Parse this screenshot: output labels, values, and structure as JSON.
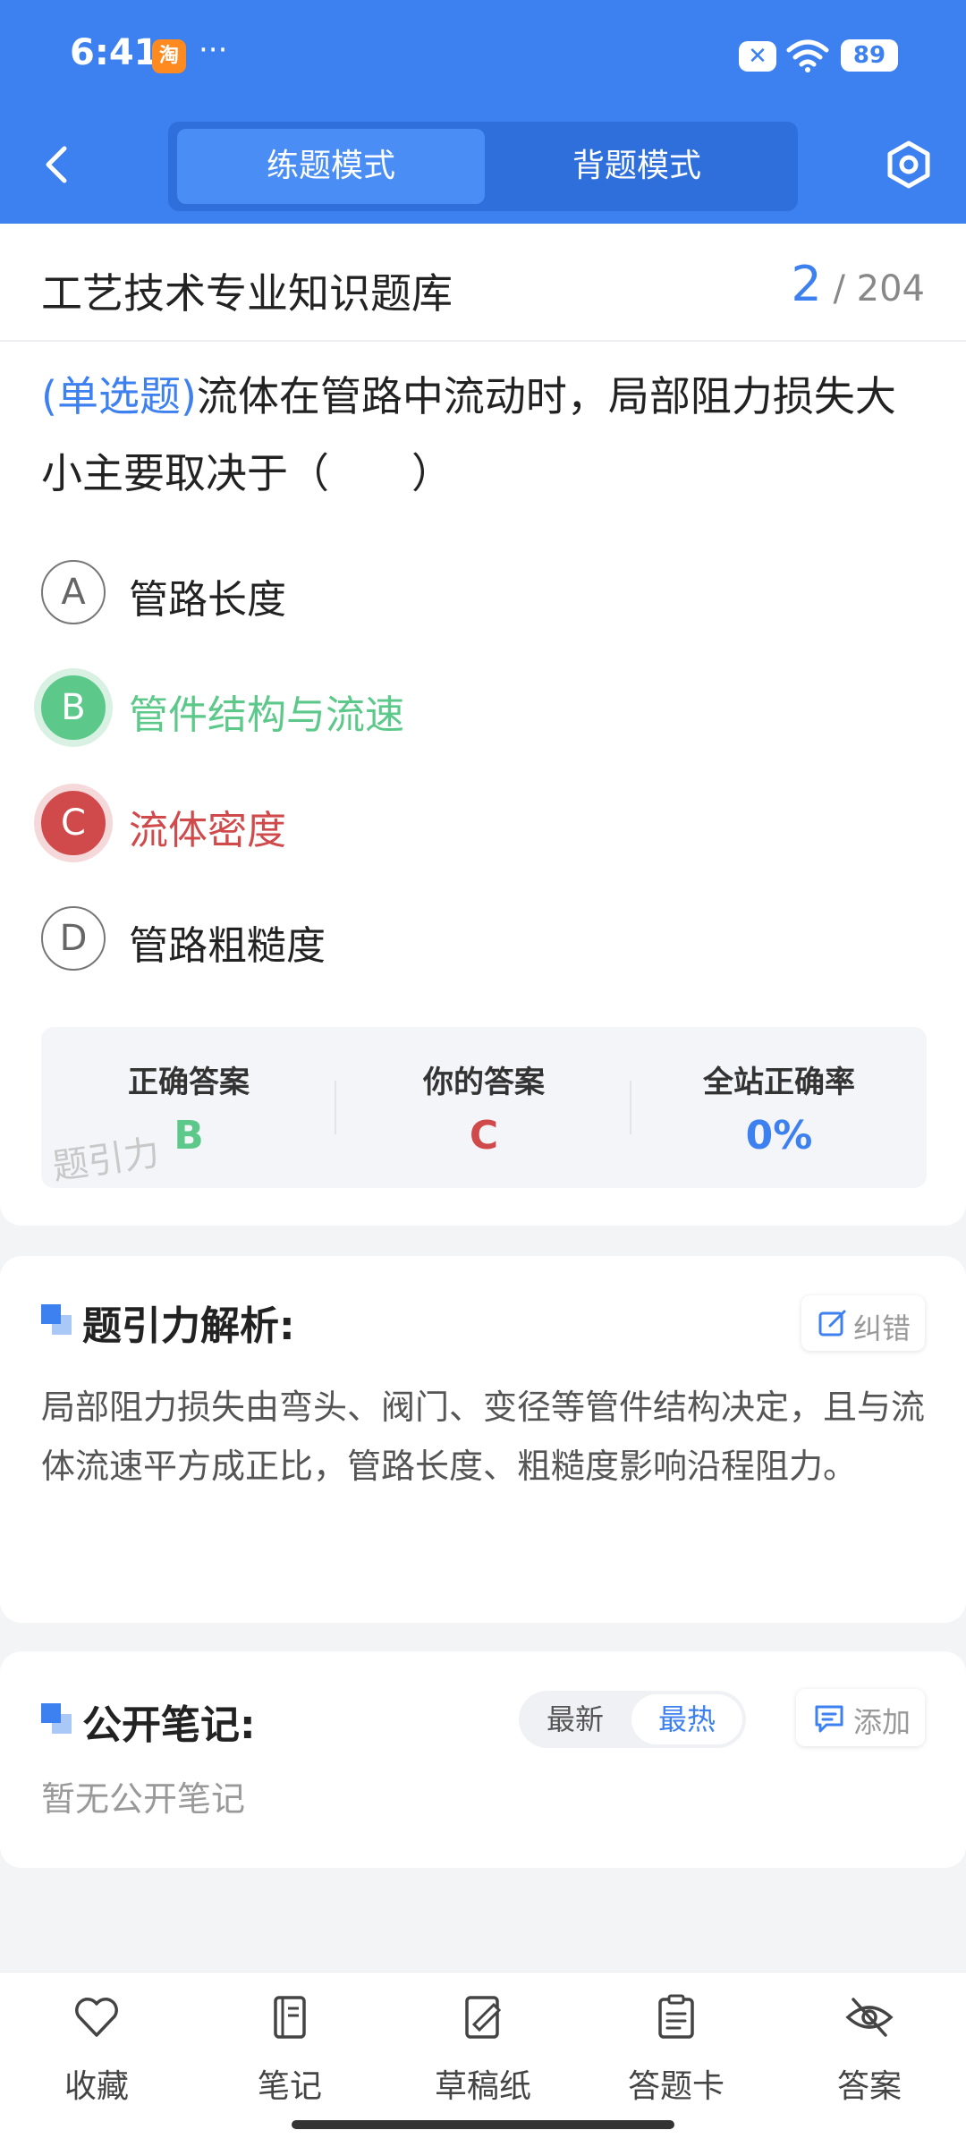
{
  "status_bar": {
    "time": "6:41",
    "app_badge": "淘",
    "more": "···",
    "battery": "89"
  },
  "header": {
    "tabs": [
      "练题模式",
      "背题模式"
    ],
    "active_tab": "练题模式"
  },
  "bank": {
    "title": "工艺技术专业知识题库",
    "current": "2",
    "total": "/ 204"
  },
  "question": {
    "type": "(单选题)",
    "text": "流体在管路中流动时，局部阻力损失大小主要取决于（　　）",
    "options": [
      {
        "letter": "A",
        "text": "管路长度",
        "state": "normal"
      },
      {
        "letter": "B",
        "text": "管件结构与流速",
        "state": "correct"
      },
      {
        "letter": "C",
        "text": "流体密度",
        "state": "wrong"
      },
      {
        "letter": "D",
        "text": "管路粗糙度",
        "state": "normal"
      }
    ]
  },
  "answer_summary": {
    "correct_label": "正确答案",
    "correct_value": "B",
    "yours_label": "你的答案",
    "yours_value": "C",
    "rate_label": "全站正确率",
    "rate_value": "0%",
    "watermark": "题引力"
  },
  "analysis": {
    "title": "题引力解析:",
    "fix_label": "纠错",
    "text": "局部阻力损失由弯头、阀门、变径等管件结构决定，且与流体流速平方成正比，管路长度、粗糙度影响沿程阻力。"
  },
  "notes": {
    "title": "公开笔记:",
    "sort_newest": "最新",
    "sort_hot": "最热",
    "add_label": "添加",
    "empty": "暂无公开笔记"
  },
  "bottom_nav": [
    "收藏",
    "笔记",
    "草稿纸",
    "答题卡",
    "答案"
  ],
  "colors": {
    "primary": "#3d80ef",
    "correct": "#5cc98a",
    "wrong": "#d0494b"
  }
}
